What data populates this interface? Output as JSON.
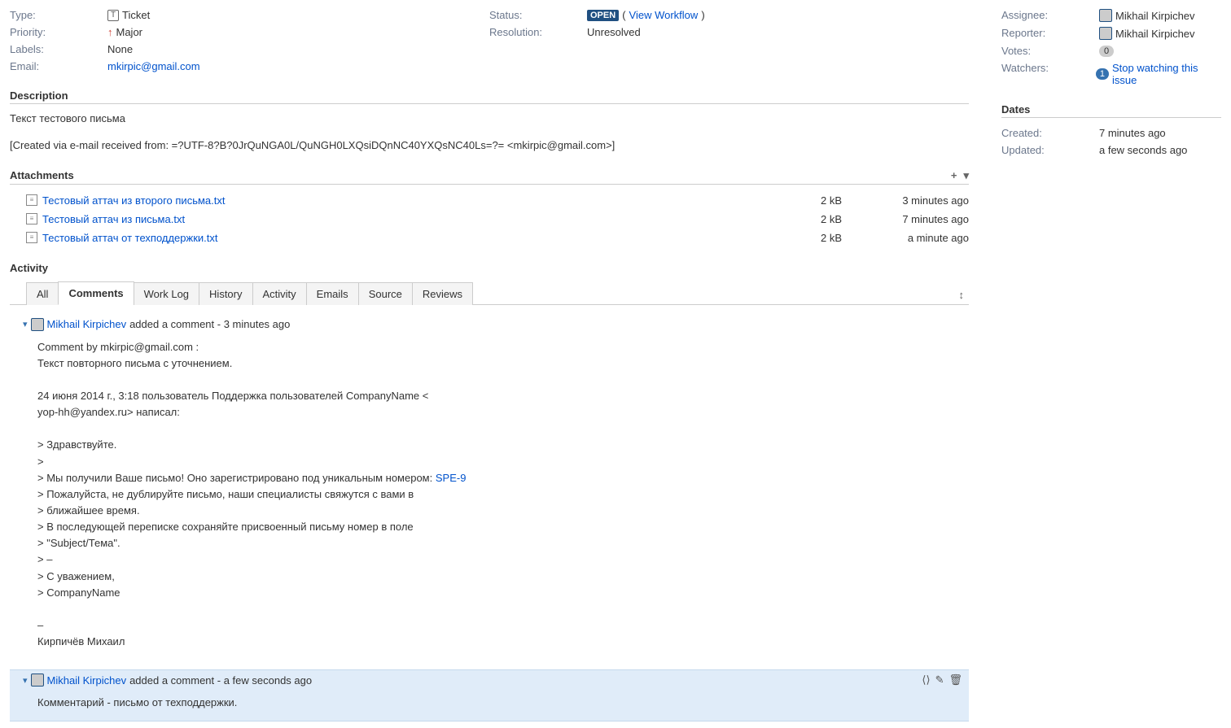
{
  "details": {
    "type_label": "Type:",
    "type_value": "Ticket",
    "priority_label": "Priority:",
    "priority_value": "Major",
    "labels_label": "Labels:",
    "labels_value": "None",
    "email_label": "Email:",
    "email_value": "mkirpic@gmail.com",
    "status_label": "Status:",
    "status_value": "OPEN",
    "view_workflow": "View Workflow",
    "resolution_label": "Resolution:",
    "resolution_value": "Unresolved"
  },
  "description": {
    "header": "Description",
    "line1": "Текст тестового письма",
    "line2": "[Created via e-mail received from: =?UTF-8?B?0JrQuNGA0L/QuNGH0LXQsiDQnNC40YXQsNC40Ls=?= <mkirpic@gmail.com>]"
  },
  "attachments": {
    "header": "Attachments",
    "items": [
      {
        "name": "Тестовый аттач из второго письма.txt",
        "size": "2 kB",
        "time": "3 minutes ago"
      },
      {
        "name": "Тестовый аттач из письма.txt",
        "size": "2 kB",
        "time": "7 minutes ago"
      },
      {
        "name": "Тестовый аттач от техподдержки.txt",
        "size": "2 kB",
        "time": "a minute ago"
      }
    ]
  },
  "activity": {
    "header": "Activity",
    "tabs": [
      "All",
      "Comments",
      "Work Log",
      "History",
      "Activity",
      "Emails",
      "Source",
      "Reviews"
    ]
  },
  "comments": [
    {
      "author": "Mikhail Kirpichev",
      "meta": " added a comment - 3 minutes ago",
      "lines": [
        "Comment by mkirpic@gmail.com :",
        "Текст повторного письма с уточнением.",
        "",
        "24 июня 2014 г., 3:18 пользователь Поддержка пользователей CompanyName <",
        "yop-hh@yandex.ru> написал:",
        "",
        "> Здравствуйте.",
        ">",
        "> Мы получили Ваше письмо! Оно зарегистрировано под уникальным номером: ",
        "> Пожалуйста, не дублируйте письмо, наши специалисты свяжутся с вами в",
        "> ближайшее время.",
        "> В последующей переписке сохраняйте присвоенный письму номер в поле",
        "> \"Subject/Тема\".",
        "> –",
        "> С уважением,",
        "> CompanyName",
        "",
        "–",
        "Кирпичёв Михаил"
      ],
      "issue_link": "SPE-9"
    },
    {
      "author": "Mikhail Kirpichev",
      "meta": " added a comment - a few seconds ago",
      "lines": [
        "Комментарий - письмо от техподдержки."
      ]
    }
  ],
  "people": {
    "assignee_label": "Assignee:",
    "assignee_value": "Mikhail Kirpichev",
    "reporter_label": "Reporter:",
    "reporter_value": "Mikhail Kirpichev",
    "votes_label": "Votes:",
    "votes_value": "0",
    "watchers_label": "Watchers:",
    "watchers_count": "1",
    "watchers_link": "Stop watching this issue"
  },
  "dates": {
    "header": "Dates",
    "created_label": "Created:",
    "created_value": "7 minutes ago",
    "updated_label": "Updated:",
    "updated_value": "a few seconds ago"
  }
}
